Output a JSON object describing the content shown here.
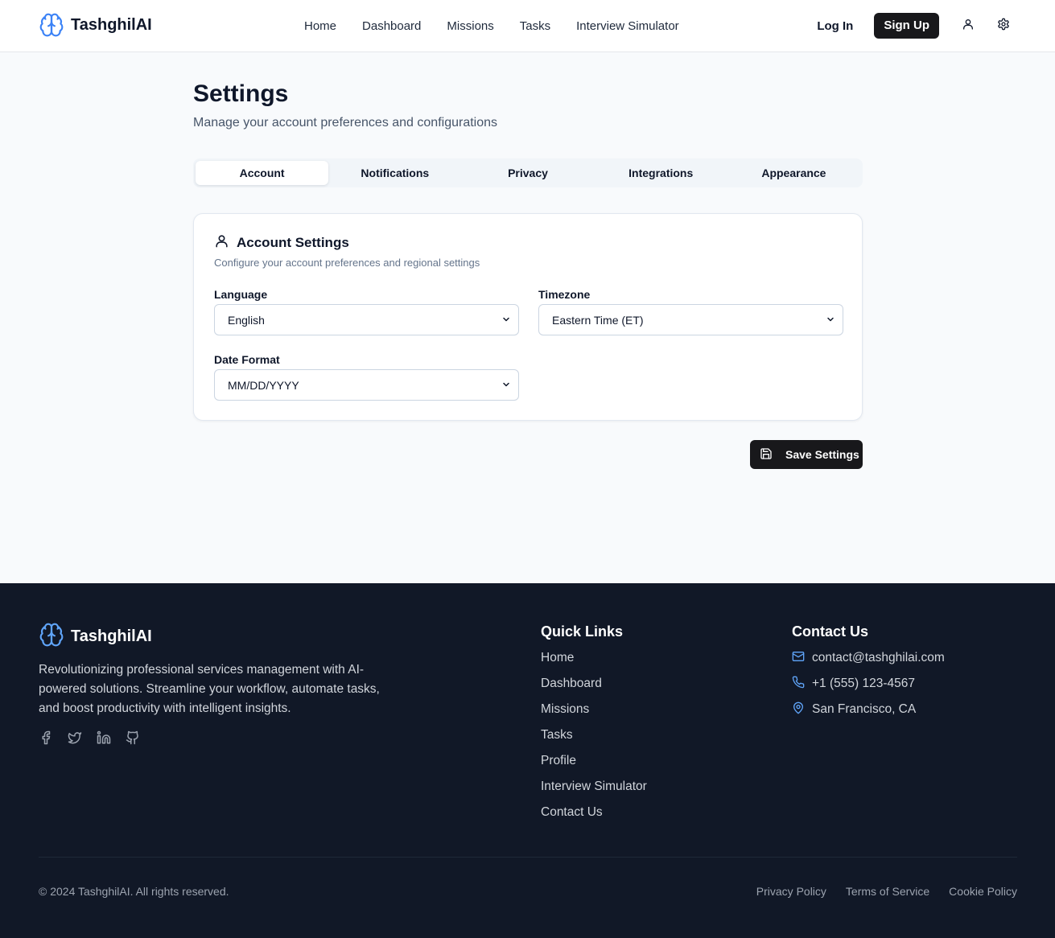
{
  "brand": {
    "name": "TashghilAI",
    "accent": "#3b82f6"
  },
  "nav": {
    "links": [
      "Home",
      "Dashboard",
      "Missions",
      "Tasks",
      "Interview Simulator"
    ],
    "login": "Log In",
    "signup": "Sign Up",
    "icons": [
      "user-icon",
      "gear-icon"
    ]
  },
  "page": {
    "title": "Settings",
    "subtitle": "Manage your account preferences and configurations"
  },
  "tabs": [
    "Account",
    "Notifications",
    "Privacy",
    "Integrations",
    "Appearance"
  ],
  "active_tab": "Account",
  "card": {
    "title": "Account Settings",
    "description": "Configure your account preferences and regional settings",
    "fields": {
      "language": {
        "label": "Language",
        "value": "English"
      },
      "timezone": {
        "label": "Timezone",
        "value": "Eastern Time (ET)"
      },
      "date_format": {
        "label": "Date Format",
        "value": "MM/DD/YYYY"
      }
    }
  },
  "save_button": "Save Settings",
  "footer": {
    "brand": "TashghilAI",
    "description": "Revolutionizing professional services management with AI-powered solutions. Streamline your workflow, automate tasks, and boost productivity with intelligent insights.",
    "social_icons": [
      "facebook-icon",
      "twitter-icon",
      "linkedin-icon",
      "github-icon"
    ],
    "quick_links_title": "Quick Links",
    "quick_links": [
      "Home",
      "Dashboard",
      "Missions",
      "Tasks",
      "Profile",
      "Interview Simulator",
      "Contact Us"
    ],
    "contact_title": "Contact Us",
    "contact": {
      "email": "contact@tashghilai.com",
      "phone": "+1 (555) 123-4567",
      "location": "San Francisco, CA"
    },
    "copyright": "© 2024 TashghilAI. All rights reserved.",
    "legal": [
      "Privacy Policy",
      "Terms of Service",
      "Cookie Policy"
    ]
  }
}
